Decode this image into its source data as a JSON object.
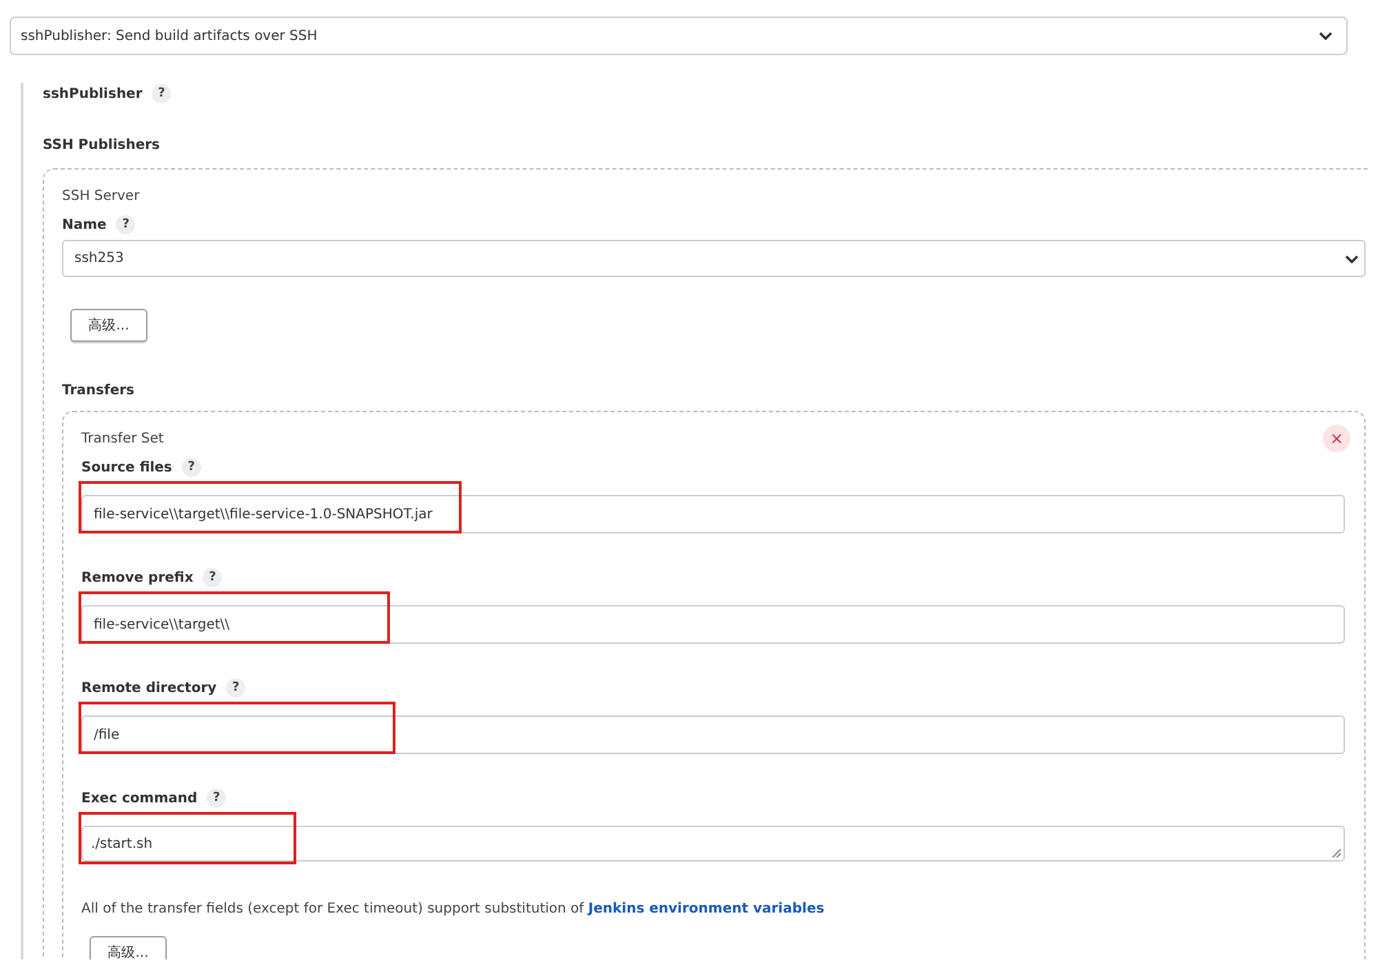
{
  "step_select": {
    "value": "sshPublisher: Send build artifacts over SSH"
  },
  "publisher_label": "sshPublisher",
  "publishers_heading": "SSH Publishers",
  "server": {
    "title": "SSH Server",
    "name_label": "Name",
    "name_value": "ssh253",
    "advanced_button": "高级..."
  },
  "transfers_heading": "Transfers",
  "transfer_set": {
    "title": "Transfer Set",
    "fields": [
      {
        "label": "Source files",
        "value": "file-service\\\\target\\\\file-service-1.0-SNAPSHOT.jar",
        "kind": "input",
        "highlighted": true
      },
      {
        "label": "Remove prefix",
        "value": "file-service\\\\target\\\\",
        "kind": "input",
        "highlighted": true
      },
      {
        "label": "Remote directory",
        "value": "/file",
        "kind": "input",
        "highlighted": true
      },
      {
        "label": "Exec command",
        "value": "./start.sh",
        "kind": "textarea",
        "highlighted": true
      }
    ],
    "note": "All of the transfer fields (except for Exec timeout) support substitution of ",
    "note_link": "Jenkins environment variables",
    "advanced_button": "高级..."
  },
  "help_mark": "?",
  "remove_mark": "×"
}
